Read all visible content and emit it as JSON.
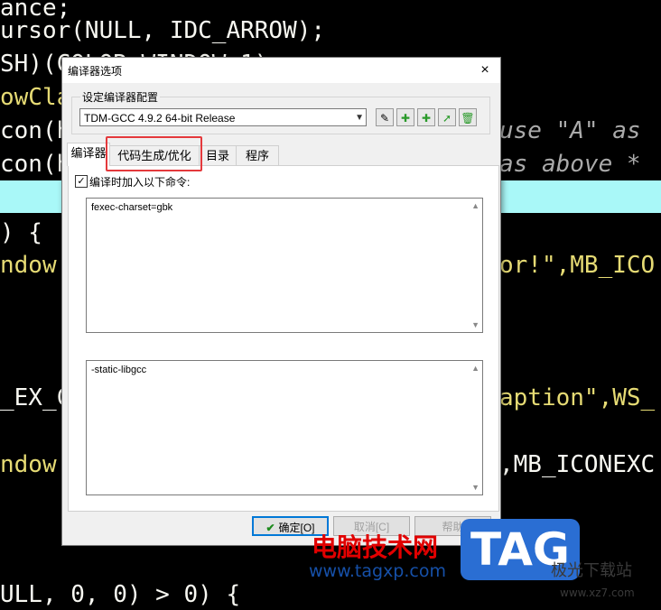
{
  "code": {
    "lines": [
      "ance;",
      "ursor(NULL, IDC_ARROW);",
      "SH)(COLOR_WINDOW+1);",
      "owCla",
      "con(h",
      "con(h",
      ") {",
      "ndow",
      "_EX_C",
      "ndow"
    ],
    "right": [
      "use \"A\" as",
      "as above *",
      "or!\",MB_ICO",
      "aption\",WS_",
      ",MB_ICONEXC"
    ],
    "bottom": "ULL, 0, 0) > 0) {"
  },
  "dialog": {
    "title": "编译器选项",
    "close": "×",
    "group_label": "设定编译器配置",
    "compiler_select": "TDM-GCC 4.9.2 64-bit Release",
    "toolbar_icons": [
      "rename-icon",
      "add-icon",
      "add-copy-icon",
      "export-icon",
      "delete-icon"
    ],
    "tabs": [
      {
        "label": "编译器",
        "active": true
      },
      {
        "label": "代码生成/优化",
        "active": false
      },
      {
        "label": "目录",
        "active": false
      },
      {
        "label": "程序",
        "active": false
      }
    ],
    "checkbox_label": "编译时加入以下命令:",
    "checkbox_checked": true,
    "compiler_commands": "fexec-charset=gbk",
    "linker_commands": "-static-libgcc",
    "ok_button": "确定[O]",
    "cancel_button": "取消[C]",
    "help_button": "帮助"
  },
  "watermark": {
    "cn": "电脑技术网",
    "url": "www.tagxp.com",
    "tag": "TAG",
    "dl": "极光下载站",
    "dl_url": "www.xz7.com"
  },
  "colors": {
    "accent": "#0078d7",
    "highlight": "#e4393c"
  }
}
